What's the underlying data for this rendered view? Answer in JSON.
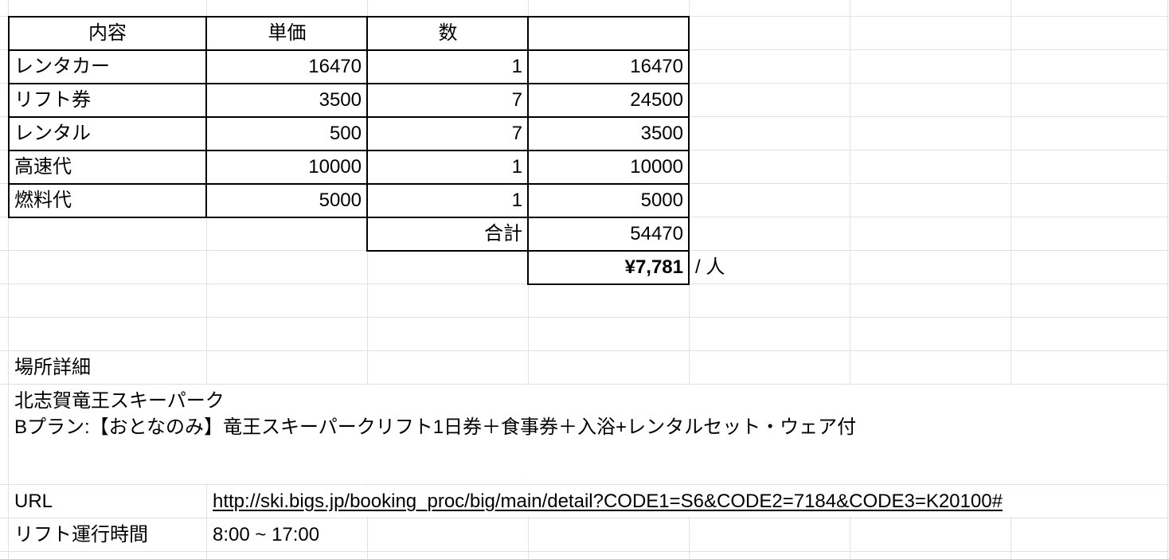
{
  "table": {
    "headers": [
      "内容",
      "単価",
      "数",
      ""
    ],
    "rows": [
      {
        "item": "レンタカー",
        "price": "16470",
        "qty": "1",
        "total": "16470"
      },
      {
        "item": "リフト券",
        "price": "3500",
        "qty": "7",
        "total": "24500"
      },
      {
        "item": "レンタル",
        "price": "500",
        "qty": "7",
        "total": "3500"
      },
      {
        "item": "高速代",
        "price": "10000",
        "qty": "1",
        "total": "10000"
      },
      {
        "item": "燃料代",
        "price": "5000",
        "qty": "1",
        "total": "5000"
      }
    ],
    "sum_label": "合計",
    "sum_value": "54470",
    "per_person_value": "¥7,781",
    "per_person_unit": "/ 人"
  },
  "details": {
    "location_label": "場所詳細",
    "location_name": "北志賀竜王スキーパーク",
    "plan": "Bプラン:【おとなのみ】竜王スキーパークリフト1日券＋食事券＋入浴+レンタルセット・ウェア付",
    "url_label": "URL",
    "url": "http://ski.bigs.jp/booking_proc/big/main/detail?CODE1=S6&CODE2=7184&CODE3=K20100#",
    "hours_label": "リフト運行時間",
    "hours_value": "8:00 ~ 17:00"
  }
}
